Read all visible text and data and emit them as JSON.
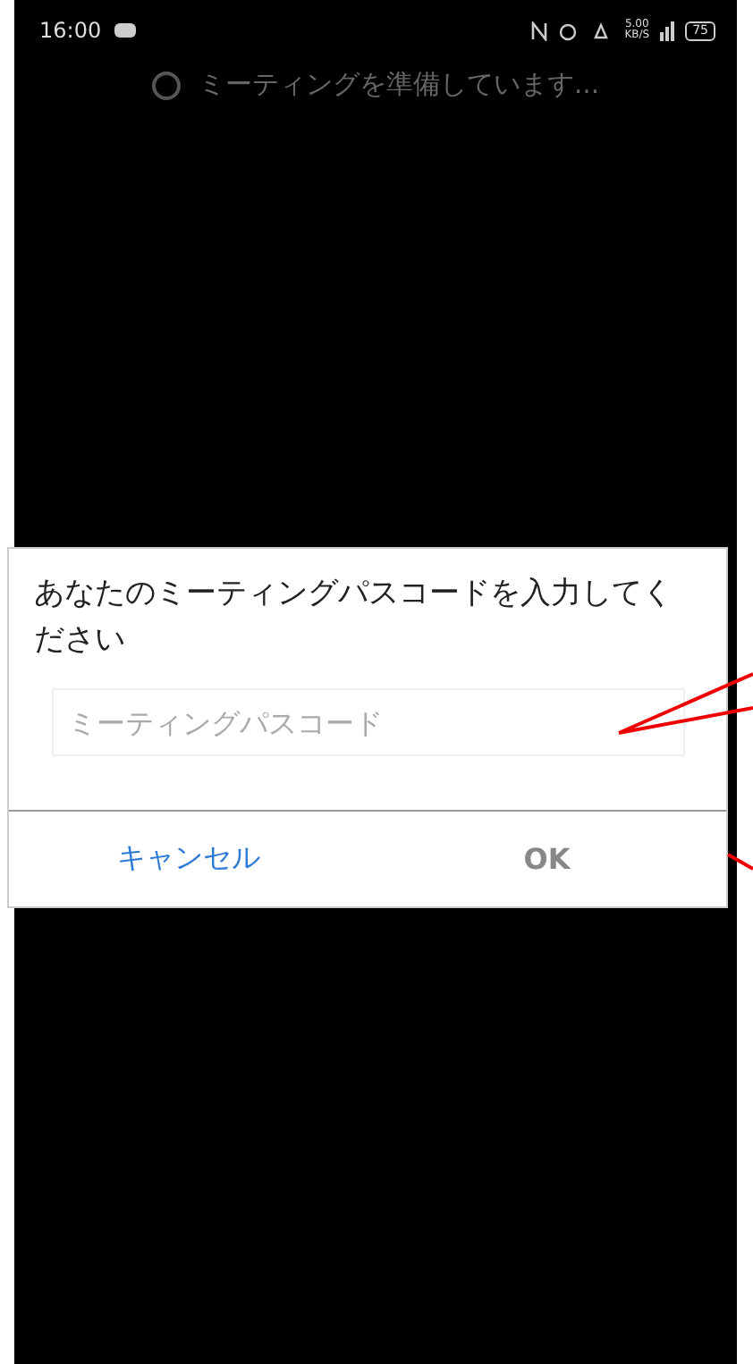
{
  "status_bar": {
    "time": "16:00",
    "net_speed": "5.00",
    "net_speed_unit": "KB/S",
    "battery": "75"
  },
  "loading": {
    "text": "ミーティングを準備しています..."
  },
  "dialog": {
    "title": "あなたのミーティングパスコードを入力してください",
    "field": {
      "placeholder": "ミーティングパスコード"
    },
    "buttons": [
      {
        "label": "キャンセル",
        "kind": "cancel",
        "disabled": false
      },
      {
        "label": "OK",
        "kind": "confirm",
        "disabled": true
      }
    ]
  }
}
